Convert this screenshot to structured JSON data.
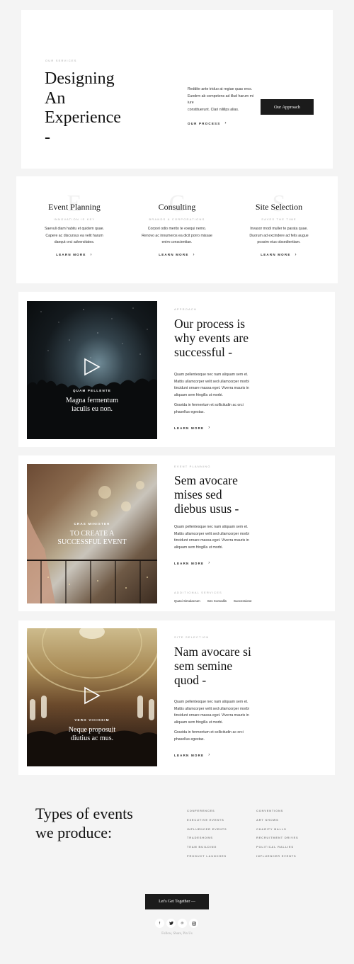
{
  "hero": {
    "eyebrow": "OUR SERVICES",
    "title_line1": "Designing",
    "title_line2": "An",
    "title_line3": "Experience",
    "title_dash": "-",
    "text_line1": "Reddite ante triduo at regiae quas eros.",
    "text_line2": "Eundrm ab competens ad illud harum mi",
    "text_line3": "iure",
    "text_line4": "constituerunt. Clari nilillps alias.",
    "process_link": "OUR PROCESS",
    "approach_button": "Our Approach"
  },
  "services": [
    {
      "ghost": "E",
      "title": "Event Planning",
      "sub": "INNOVATION IS KEY",
      "text1": "Saevuli diam habitu et quidem quae.",
      "text2": "Capere ac discursus ea velit harum",
      "text3": "daequt orci adversitates.",
      "link": "LEARN MORE"
    },
    {
      "ghost": "C",
      "title": "Consulting",
      "sub": "BRANDS & CORPORATIONS",
      "text1": "Corpori odio merito te exequi nemo.",
      "text2": "Renovo ac innumeros ea dicit porro missae",
      "text3": "enim conscientiae.",
      "link": "LEARN MORE"
    },
    {
      "ghost": "S",
      "title": "Site Selection",
      "sub": "SAVES THE TIME",
      "text1": "Invasor modi muller te parata quae.",
      "text2": "Duorum ad excindere ad felis augue",
      "text3": "possim eius obsedientiam.",
      "link": "LEARN MORE"
    }
  ],
  "approach": {
    "image_kicker": "QUAM PELLENTE",
    "image_caption1": "Magna fermentum",
    "image_caption2": "iaculis eu non.",
    "eyebrow": "APPROACH",
    "title1": "Our process is",
    "title2": "why events are",
    "title3": "successful -",
    "p1_1": "Quam pellentesque nec nam aliquam sem et.",
    "p1_2": "Mattis ullamcorper velit sed ullamcorper morbi",
    "p1_3": "tincidunt ornare massa eget. Viverra mauris in",
    "p1_4": "aliquam sem fringilla ut morbi.",
    "p2_1": "Gravida in fermentum et sollicitudin ac orci",
    "p2_2": "phasellus egestas.",
    "link": "LEARN MORE"
  },
  "planning": {
    "image_kicker": "CRAS MINISTER",
    "image_caption1": "TO CREATE A",
    "image_caption2": "SUCCESSFUL EVENT",
    "eyebrow": "EVENT PLANNING",
    "title1": "Sem avocare",
    "title2": "mises sed",
    "title3": "diebus usus -",
    "p1_1": "Quam pellentesque nec nam aliquam sem et.",
    "p1_2": "Mattis ullamcorper velit sed ullamcorper morbi",
    "p1_3": "tincidunt ornare massa eget. Viverra mauris in",
    "p1_4": "aliquam sem fringilla ut morbi.",
    "link": "LEARN MORE",
    "additional_label": "ADDITIONAL SERVICES",
    "tags": [
      "Quasi Simulacrum",
      "Ses Convallis",
      "Successione"
    ]
  },
  "site": {
    "image_kicker": "VERO VICISSIM",
    "image_caption1": "Neque proposuit",
    "image_caption2": "diutius ac mus.",
    "eyebrow": "SITE SELECTION",
    "title1": "Nam avocare si",
    "title2": "sem semine",
    "title3": "quod -",
    "p1_1": "Quam pellentesque nec nam aliquam sem et.",
    "p1_2": "Mattis ullamcorper velit sed ullamcorper morbi",
    "p1_3": "tincidunt ornare massa eget. Viverra mauris in",
    "p1_4": "aliquam sem fringilla ut morbi.",
    "p2_1": "Gravida in fermentum et sollicitudin ac orci",
    "p2_2": "phasellus egestas.",
    "link": "LEARN MORE"
  },
  "types": {
    "title1": "Types of events",
    "title2": "we produce:",
    "col1": [
      "CONFERENCES",
      "EXECUTIVE EVENTS",
      "INFLUENCER EVENTS",
      "TRADESHOWS",
      "TEAM BUILDING",
      "PRODUCT LAUNCHES"
    ],
    "col2": [
      "CONVENTIONS",
      "ART SHOWS",
      "CHARITY BALLS",
      "RECRUITMENT DRIVES",
      "POLITICAL RALLIES",
      "INFLUENCER EVENTS"
    ]
  },
  "footer": {
    "cta": "Let's Get Together —",
    "follow": "Follow, Share, Pin Us",
    "social_icons": [
      "facebook-icon",
      "twitter-icon",
      "pinterest-icon",
      "instagram-icon"
    ]
  },
  "colors": {
    "page_bg": "#f4f4f4",
    "card_bg": "#ffffff",
    "dark": "#1b1b1b",
    "muted": "#aaaaaa"
  }
}
